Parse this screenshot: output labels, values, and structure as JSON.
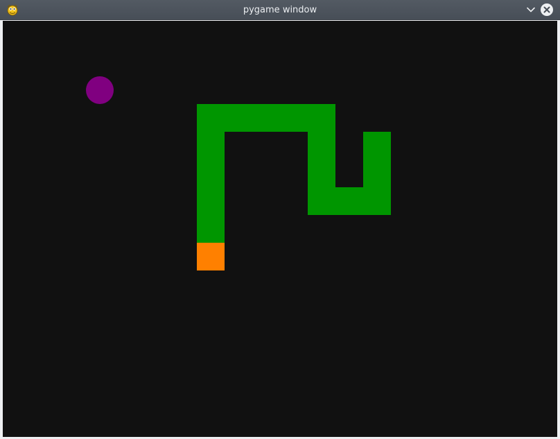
{
  "window": {
    "title": "pygame window",
    "icons": {
      "app": "pygame-snake-icon",
      "menu": "chevron-down-icon",
      "close": "close-icon"
    }
  },
  "game": {
    "background_color": "#111111",
    "snake": {
      "body_color": "#009600",
      "head_color": "#ff8000",
      "segments": [
        {
          "col": 7,
          "row": 8,
          "part": "head"
        },
        {
          "col": 7,
          "row": 7,
          "part": "body"
        },
        {
          "col": 7,
          "row": 6,
          "part": "body"
        },
        {
          "col": 7,
          "row": 5,
          "part": "body"
        },
        {
          "col": 7,
          "row": 4,
          "part": "body"
        },
        {
          "col": 7,
          "row": 3,
          "part": "body"
        },
        {
          "col": 8,
          "row": 3,
          "part": "body"
        },
        {
          "col": 9,
          "row": 3,
          "part": "body"
        },
        {
          "col": 10,
          "row": 3,
          "part": "body"
        },
        {
          "col": 11,
          "row": 3,
          "part": "body"
        },
        {
          "col": 11,
          "row": 4,
          "part": "body"
        },
        {
          "col": 11,
          "row": 5,
          "part": "body"
        },
        {
          "col": 11,
          "row": 6,
          "part": "body"
        },
        {
          "col": 12,
          "row": 6,
          "part": "body"
        },
        {
          "col": 13,
          "row": 6,
          "part": "body"
        },
        {
          "col": 13,
          "row": 5,
          "part": "body"
        },
        {
          "col": 13,
          "row": 4,
          "part": "body"
        }
      ]
    },
    "food": {
      "col": 3,
      "row": 2,
      "color": "#800080"
    }
  }
}
